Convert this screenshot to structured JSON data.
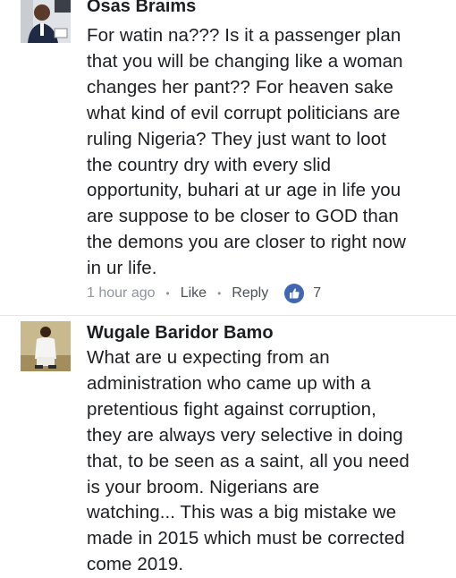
{
  "comments": [
    {
      "author": "Osas Braims",
      "lines": [
        "For watin na??? Is it a passenger plan",
        "that you will be changing like a woman",
        "changes her pant?? For heaven sake",
        "what kind of evil corrupt politicians are",
        "ruling Nigeria? They just want to loot",
        "the country dry with every slid",
        "opportunity, buhari at ur age in life you",
        "are suppose to be closer to GOD than",
        "the demons you are closer to right now",
        "in ur life."
      ],
      "time": "1 hour ago",
      "like_label": "Like",
      "reply_label": "Reply",
      "reaction_count": "7"
    },
    {
      "author": "Wugale Baridor Bamo",
      "lines": [
        "What are u expecting from an",
        "administration who came up with a",
        "pretentious fight against corruption,",
        "they are always very selective in doing",
        "that, to be seen as a saint, all you need",
        "is your broom. Nigerians are",
        "watching... This was a big mistake we",
        "made in 2015 which must be corrected",
        "come 2019."
      ]
    }
  ],
  "icons": {
    "reaction": "thumbs-up-icon"
  },
  "colors": {
    "accent": "#4267b2",
    "meta_text": "#90949c",
    "body_text": "#1c1e21"
  }
}
